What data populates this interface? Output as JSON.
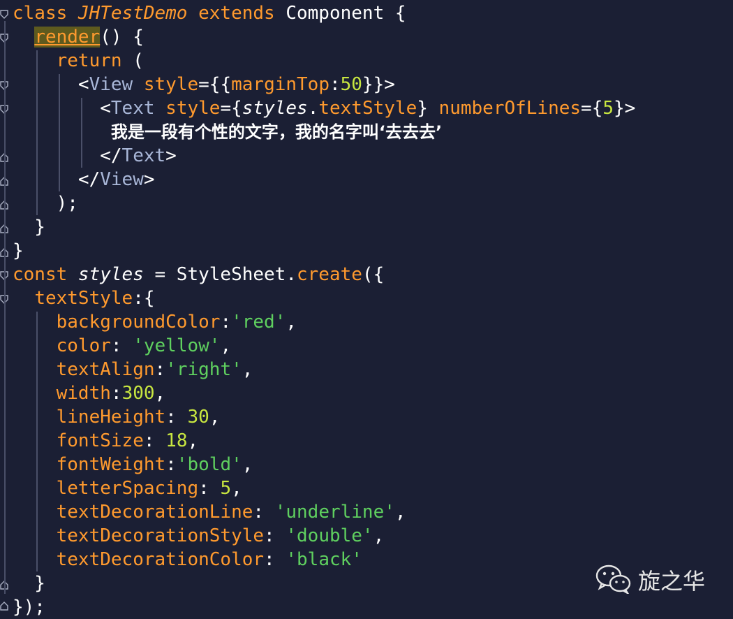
{
  "lines": [
    [
      [
        "kw",
        "class "
      ],
      [
        "cls",
        "JHTestDemo "
      ],
      [
        "kw",
        "extends "
      ],
      [
        "plain",
        "Component {"
      ]
    ],
    [
      [
        "plain",
        "  "
      ],
      [
        "hl",
        "render"
      ],
      [
        "plain",
        "() {"
      ]
    ],
    [
      [
        "plain",
        "    "
      ],
      [
        "kw",
        "return"
      ],
      [
        "plain",
        " ("
      ]
    ],
    [
      [
        "plain",
        "      <"
      ],
      [
        "tag",
        "View "
      ],
      [
        "attr",
        "style"
      ],
      [
        "plain",
        "={{"
      ],
      [
        "attr",
        "marginTop"
      ],
      [
        "plain",
        ":"
      ],
      [
        "num",
        "50"
      ],
      [
        "plain",
        "}}>"
      ]
    ],
    [
      [
        "plain",
        "        <"
      ],
      [
        "tag",
        "Text "
      ],
      [
        "attr",
        "style"
      ],
      [
        "plain",
        "={"
      ],
      [
        "ital",
        "styles"
      ],
      [
        "plain",
        "."
      ],
      [
        "attr",
        "textStyle"
      ],
      [
        "plain",
        "} "
      ],
      [
        "attr",
        "numberOfLines"
      ],
      [
        "plain",
        "={"
      ],
      [
        "num",
        "5"
      ],
      [
        "plain",
        "}>"
      ]
    ],
    [
      [
        "plain",
        "         "
      ],
      [
        "cjk",
        "我是一段有个性的文字，我的名字叫‘去去去’"
      ]
    ],
    [
      [
        "plain",
        "        </"
      ],
      [
        "tag",
        "Text"
      ],
      [
        "plain",
        ">"
      ]
    ],
    [
      [
        "plain",
        "      </"
      ],
      [
        "tag",
        "View"
      ],
      [
        "plain",
        ">"
      ]
    ],
    [
      [
        "plain",
        "    );"
      ]
    ],
    [
      [
        "plain",
        "  }"
      ]
    ],
    [
      [
        "plain",
        "}"
      ]
    ],
    [
      [
        "kw",
        "const "
      ],
      [
        "ital",
        "styles"
      ],
      [
        "plain",
        " = StyleSheet."
      ],
      [
        "fn",
        "create"
      ],
      [
        "plain",
        "({"
      ]
    ],
    [
      [
        "plain",
        "  "
      ],
      [
        "attr",
        "textStyle"
      ],
      [
        "plain",
        ":{"
      ]
    ],
    [
      [
        "plain",
        "    "
      ],
      [
        "attr",
        "backgroundColor"
      ],
      [
        "plain",
        ":"
      ],
      [
        "str",
        "'red'"
      ],
      [
        "plain",
        ","
      ]
    ],
    [
      [
        "plain",
        "    "
      ],
      [
        "attr",
        "color"
      ],
      [
        "plain",
        ": "
      ],
      [
        "str",
        "'yellow'"
      ],
      [
        "plain",
        ","
      ]
    ],
    [
      [
        "plain",
        "    "
      ],
      [
        "attr",
        "textAlign"
      ],
      [
        "plain",
        ":"
      ],
      [
        "str",
        "'right'"
      ],
      [
        "plain",
        ","
      ]
    ],
    [
      [
        "plain",
        "    "
      ],
      [
        "attr",
        "width"
      ],
      [
        "plain",
        ":"
      ],
      [
        "num",
        "300"
      ],
      [
        "plain",
        ","
      ]
    ],
    [
      [
        "plain",
        "    "
      ],
      [
        "attr",
        "lineHeight"
      ],
      [
        "plain",
        ": "
      ],
      [
        "num",
        "30"
      ],
      [
        "plain",
        ","
      ]
    ],
    [
      [
        "plain",
        "    "
      ],
      [
        "attr",
        "fontSize"
      ],
      [
        "plain",
        ": "
      ],
      [
        "num",
        "18"
      ],
      [
        "plain",
        ","
      ]
    ],
    [
      [
        "plain",
        "    "
      ],
      [
        "attr",
        "fontWeight"
      ],
      [
        "plain",
        ":"
      ],
      [
        "str",
        "'bold'"
      ],
      [
        "plain",
        ","
      ]
    ],
    [
      [
        "plain",
        "    "
      ],
      [
        "attr",
        "letterSpacing"
      ],
      [
        "plain",
        ": "
      ],
      [
        "num",
        "5"
      ],
      [
        "plain",
        ","
      ]
    ],
    [
      [
        "plain",
        "    "
      ],
      [
        "attr",
        "textDecorationLine"
      ],
      [
        "plain",
        ": "
      ],
      [
        "str",
        "'underline'"
      ],
      [
        "plain",
        ","
      ]
    ],
    [
      [
        "plain",
        "    "
      ],
      [
        "attr",
        "textDecorationStyle"
      ],
      [
        "plain",
        ": "
      ],
      [
        "str",
        "'double'"
      ],
      [
        "plain",
        ","
      ]
    ],
    [
      [
        "plain",
        "    "
      ],
      [
        "attr",
        "textDecorationColor"
      ],
      [
        "plain",
        ": "
      ],
      [
        "str",
        "'black'"
      ]
    ],
    [
      [
        "plain",
        "  }"
      ]
    ],
    [
      [
        "plain",
        "});"
      ]
    ]
  ],
  "watermark": {
    "text": "旋之华",
    "icon": "wechat-icon"
  },
  "colors": {
    "background": "#1b1f34",
    "keyword": "#ff9a2e",
    "string": "#5fd05f",
    "number": "#c8e640",
    "tag": "#a9b7d8"
  }
}
